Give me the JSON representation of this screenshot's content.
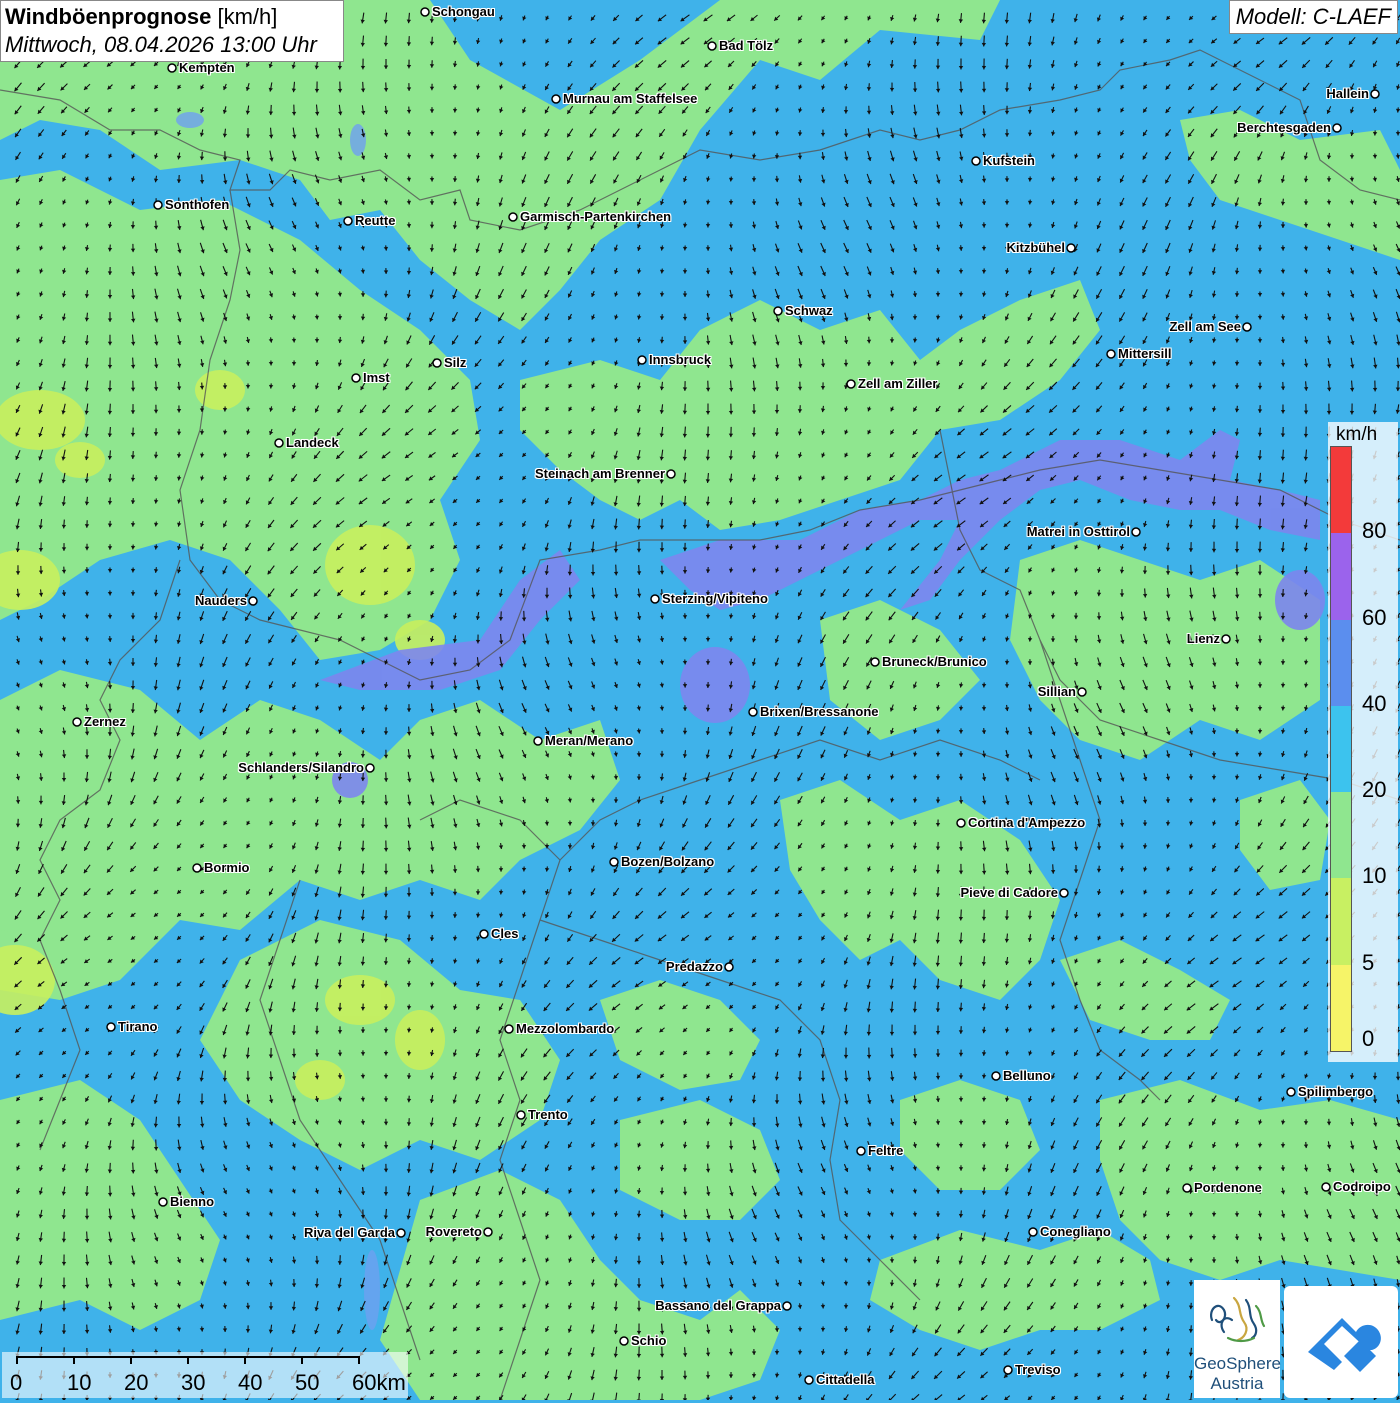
{
  "header": {
    "title": "Windböenprognose",
    "unit": "[km/h]",
    "datetime": "Mittwoch, 08.04.2026 13:00 Uhr"
  },
  "model": {
    "label": "Modell: C-LAEF"
  },
  "legend": {
    "unit": "km/h",
    "ticks": [
      "0",
      "5",
      "10",
      "20",
      "40",
      "60",
      "80"
    ],
    "colors": [
      "#f6f468",
      "#c8f062",
      "#8fe68f",
      "#3cc3ee",
      "#5b8eee",
      "#9b63ec",
      "#f33a3a"
    ]
  },
  "scale_bar": {
    "labels": [
      "0",
      "10",
      "20",
      "30",
      "40",
      "50",
      "60km"
    ]
  },
  "logos": {
    "geosphere_line1": "GeoSphere",
    "geosphere_line2": "Austria"
  },
  "cities": [
    {
      "name": "Schongau"
    },
    {
      "name": "Bad Tölz"
    },
    {
      "name": "Kempten"
    },
    {
      "name": "Murnau am Staffelsee"
    },
    {
      "name": "Hallein"
    },
    {
      "name": "Berchtesgaden"
    },
    {
      "name": "Kufstein"
    },
    {
      "name": "Sonthofen"
    },
    {
      "name": "Reutte"
    },
    {
      "name": "Garmisch-Partenkirchen"
    },
    {
      "name": "Kitzbühel"
    },
    {
      "name": "Schwaz"
    },
    {
      "name": "Zell am See"
    },
    {
      "name": "Mittersill"
    },
    {
      "name": "Imst"
    },
    {
      "name": "Silz"
    },
    {
      "name": "Innsbruck"
    },
    {
      "name": "Zell am Ziller"
    },
    {
      "name": "Landeck"
    },
    {
      "name": "Steinach am Brenner"
    },
    {
      "name": "Matrei in Osttirol"
    },
    {
      "name": "Nauders"
    },
    {
      "name": "Sterzing/Vipiteno"
    },
    {
      "name": "Lienz"
    },
    {
      "name": "Bruneck/Brunico"
    },
    {
      "name": "Sillian"
    },
    {
      "name": "Brixen/Bressanone"
    },
    {
      "name": "Zernez"
    },
    {
      "name": "Meran/Merano"
    },
    {
      "name": "Schlanders/Silandro"
    },
    {
      "name": "Cortina d'Ampezzo"
    },
    {
      "name": "Bozen/Bolzano"
    },
    {
      "name": "Bormio"
    },
    {
      "name": "Pieve di Cadore"
    },
    {
      "name": "Cles"
    },
    {
      "name": "Predazzo"
    },
    {
      "name": "Tirano"
    },
    {
      "name": "Mezzolombardo"
    },
    {
      "name": "Belluno"
    },
    {
      "name": "Spilimbergo"
    },
    {
      "name": "Trento"
    },
    {
      "name": "Feltre"
    },
    {
      "name": "Pordenone"
    },
    {
      "name": "Codroipo"
    },
    {
      "name": "Bienno"
    },
    {
      "name": "Riva del Garda"
    },
    {
      "name": "Rovereto"
    },
    {
      "name": "Conegliano"
    },
    {
      "name": "Bassano del Grappa"
    },
    {
      "name": "Schio"
    },
    {
      "name": "Treviso"
    },
    {
      "name": "Cittadella"
    }
  ]
}
